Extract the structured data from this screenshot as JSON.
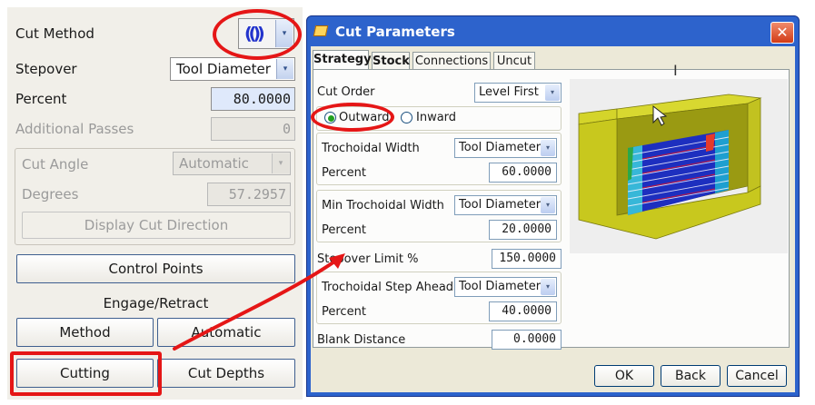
{
  "left_panel": {
    "cut_method_label": "Cut Method",
    "cut_method_icon_text": "(())",
    "stepover_label": "Stepover",
    "stepover_value": "Tool Diameter",
    "percent_label": "Percent",
    "percent_value": "80.0000",
    "additional_passes_label": "Additional Passes",
    "additional_passes_value": "0",
    "cut_angle_label": "Cut Angle",
    "cut_angle_value": "Automatic",
    "degrees_label": "Degrees",
    "degrees_value": "57.2957",
    "display_cut_direction_label": "Display Cut Direction",
    "control_points_label": "Control Points",
    "engage_retract_label": "Engage/Retract",
    "method_label": "Method",
    "automatic_label": "Automatic",
    "cutting_label": "Cutting",
    "cut_depths_label": "Cut Depths"
  },
  "dialog": {
    "title": "Cut Parameters",
    "close_glyph": "✕",
    "tabs": [
      "Strategy",
      "Stock",
      "Connections",
      "Uncut"
    ],
    "cut_order_label": "Cut Order",
    "cut_order_value": "Level First",
    "outward_label": "Outward",
    "inward_label": "Inward",
    "trochoidal_width_label": "Trochoidal Width",
    "trochoidal_width_mode": "Tool Diameter",
    "trochoidal_width_percent_label": "Percent",
    "trochoidal_width_percent": "60.0000",
    "min_trochoidal_width_label": "Min Trochoidal Width",
    "min_trochoidal_width_mode": "Tool Diameter",
    "min_trochoidal_width_percent_label": "Percent",
    "min_trochoidal_width_percent": "20.0000",
    "stepover_limit_label": "Stepover Limit %",
    "stepover_limit_value": "150.0000",
    "step_ahead_label": "Trochoidal Step Ahead",
    "step_ahead_mode": "Tool Diameter",
    "step_ahead_percent_label": "Percent",
    "step_ahead_percent": "40.0000",
    "blank_distance_label": "Blank Distance",
    "blank_distance_value": "0.0000",
    "ok_label": "OK",
    "back_label": "Back",
    "cancel_label": "Cancel"
  },
  "colors": {
    "annotation_red": "#e51616",
    "title_bar_blue": "#2d63cc",
    "part_yellow": "#c8c81e",
    "toolpath_blue": "#2a35c8"
  },
  "icons": {
    "dropdown": "▾"
  }
}
